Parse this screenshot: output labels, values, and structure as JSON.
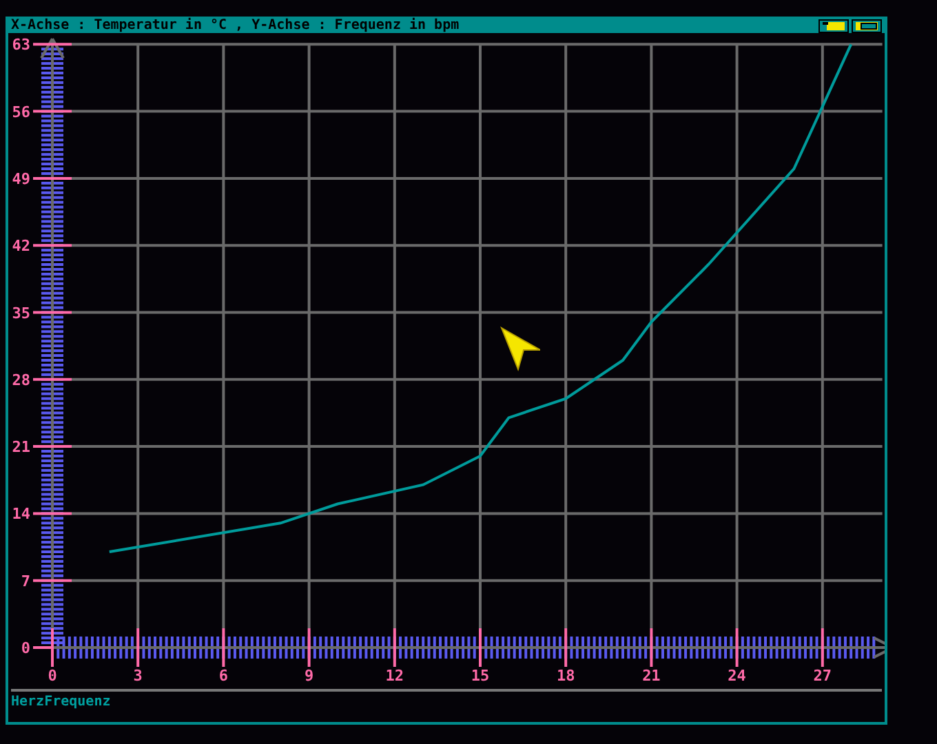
{
  "window": {
    "title": "X-Achse : Temperatur in °C , Y-Achse : Frequenz in bpm"
  },
  "chart_data": {
    "type": "line",
    "x": [
      2,
      8,
      10,
      13,
      15,
      16,
      18,
      20,
      21,
      23,
      26,
      28
    ],
    "series": [
      {
        "name": "HerzFrequenz",
        "color": "#009b9b",
        "values": [
          10,
          13,
          15,
          17,
          20,
          24,
          26,
          30,
          34,
          40,
          50,
          63
        ]
      }
    ],
    "grid": true,
    "xlim": [
      0,
      29
    ],
    "ylim": [
      0,
      63
    ],
    "xticks": [
      0,
      3,
      6,
      9,
      12,
      15,
      18,
      21,
      24,
      27
    ],
    "yticks": [
      0,
      7,
      14,
      21,
      28,
      35,
      42,
      49,
      56,
      63
    ]
  }
}
